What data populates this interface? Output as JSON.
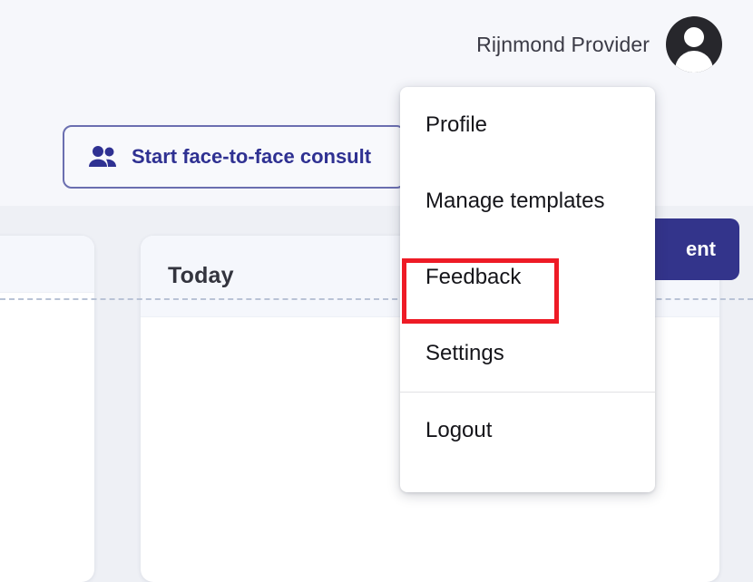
{
  "header": {
    "user_name": "Rijnmond Provider",
    "avatar_icon": "user-avatar-icon"
  },
  "toolbar": {
    "consult_button_label": "Start face-to-face consult",
    "consult_button_icon": "people-icon",
    "primary_button_label": "ent",
    "divider": "dashed-divider"
  },
  "main": {
    "card_title": "Today"
  },
  "menu": {
    "items": [
      {
        "label": "Profile",
        "name": "menu-item-profile"
      },
      {
        "label": "Manage templates",
        "name": "menu-item-manage-templates"
      },
      {
        "label": "Feedback",
        "name": "menu-item-feedback"
      },
      {
        "label": "Settings",
        "name": "menu-item-settings"
      },
      {
        "label": "Logout",
        "name": "menu-item-logout"
      }
    ]
  },
  "annotation": {
    "highlight_target": "Feedback",
    "highlight_color": "#ee1b26"
  },
  "colors": {
    "page_background": "#f6f7fb",
    "content_background": "#eef0f5",
    "primary_button": "#33348b",
    "consult_button_text": "#2f3192",
    "consult_button_border": "#6b6fb0",
    "card_header": "#f5f7fc",
    "menu_text": "#15151a",
    "avatar_background": "#27272c"
  }
}
